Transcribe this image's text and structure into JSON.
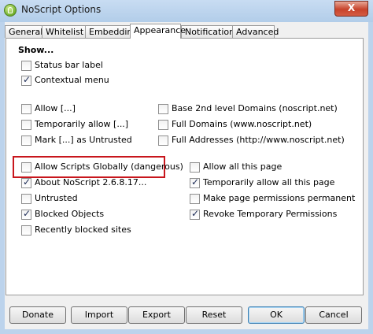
{
  "window": {
    "title": "NoScript Options",
    "close_label": "X"
  },
  "tabs": [
    {
      "label": "General"
    },
    {
      "label": "Whitelist"
    },
    {
      "label": "Embeddings"
    },
    {
      "label": "Appearance"
    },
    {
      "label": "Notifications"
    },
    {
      "label": "Advanced"
    }
  ],
  "show_heading": "Show...",
  "options": {
    "status_bar_label": {
      "label": "Status bar label",
      "checked": false
    },
    "contextual_menu": {
      "label": "Contextual menu",
      "checked": true
    },
    "allow": {
      "label": "Allow [...]",
      "checked": false
    },
    "temporarily_allow": {
      "label": "Temporarily allow [...]",
      "checked": false
    },
    "mark_untrusted": {
      "label": "Mark [...] as Untrusted",
      "checked": false
    },
    "base_2nd_level": {
      "label": "Base 2nd level Domains (noscript.net)",
      "checked": false
    },
    "full_domains": {
      "label": "Full Domains (www.noscript.net)",
      "checked": false
    },
    "full_addresses": {
      "label": "Full Addresses (http://www.noscript.net)",
      "checked": false
    },
    "allow_globally": {
      "label": "Allow Scripts Globally (dangerous)",
      "checked": false
    },
    "about_noscript": {
      "label": "About NoScript 2.6.8.17...",
      "checked": true
    },
    "untrusted": {
      "label": "Untrusted",
      "checked": false
    },
    "blocked_objects": {
      "label": "Blocked Objects",
      "checked": true
    },
    "recently_blocked": {
      "label": "Recently blocked sites",
      "checked": false
    },
    "allow_all_page": {
      "label": "Allow all this page",
      "checked": false
    },
    "temp_allow_all_page": {
      "label": "Temporarily allow all this page",
      "checked": true
    },
    "make_permanent": {
      "label": "Make page permissions permanent",
      "checked": false
    },
    "revoke_temp": {
      "label": "Revoke Temporary Permissions",
      "checked": true
    }
  },
  "buttons": {
    "donate": "Donate",
    "import": "Import",
    "export": "Export",
    "reset": "Reset",
    "ok": "OK",
    "cancel": "Cancel"
  }
}
